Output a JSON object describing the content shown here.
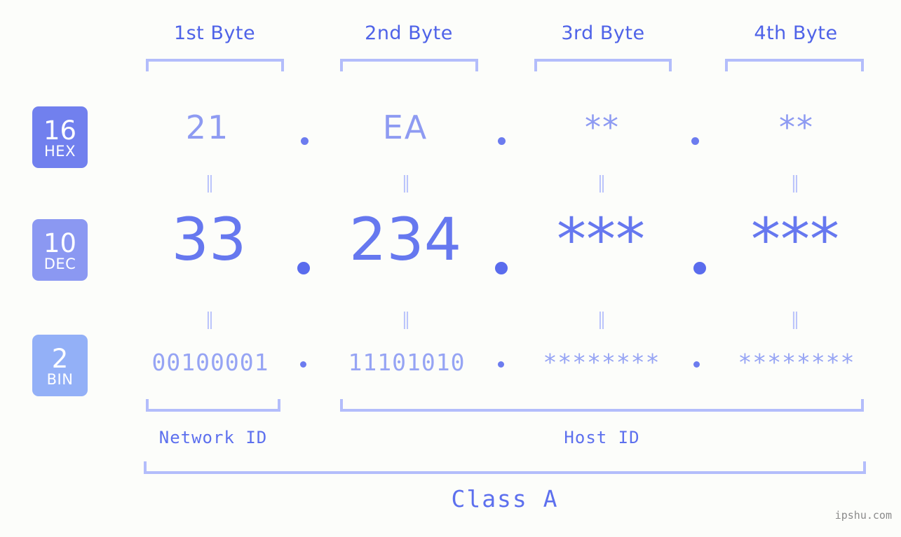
{
  "header": {
    "byte_labels": [
      "1st Byte",
      "2nd Byte",
      "3rd Byte",
      "4th Byte"
    ]
  },
  "bases": [
    {
      "number": "16",
      "name": "HEX",
      "color": "#7180ee"
    },
    {
      "number": "10",
      "name": "DEC",
      "color": "#8b98f2"
    },
    {
      "number": "2",
      "name": "BIN",
      "color": "#93b0f7"
    }
  ],
  "rows": {
    "hex": {
      "values": [
        "21",
        "EA",
        "**",
        "**"
      ],
      "separator": "."
    },
    "dec": {
      "values": [
        "33",
        "234",
        "***",
        "***"
      ],
      "separator": "."
    },
    "bin": {
      "values": [
        "00100001",
        "11101010",
        "********",
        "********"
      ],
      "separator": "."
    }
  },
  "equals": {
    "mark": "⏸",
    "row1": [
      "=",
      "=",
      "=",
      "="
    ],
    "row2": [
      "=",
      "=",
      "=",
      "="
    ]
  },
  "footer": {
    "network_id_label": "Network ID",
    "host_id_label": "Host ID",
    "class_label": "Class A",
    "watermark": "ipshu.com"
  },
  "colors": {
    "background": "#fcfdfa",
    "bracket": "#b3bdfb",
    "header_text": "#4f63e8",
    "hex_text": "#8e9bf2",
    "dec_text": "#6678ef",
    "bin_text": "#96a4f4",
    "equals": "#bcc5fb",
    "watermark": "#8a8a8a"
  }
}
